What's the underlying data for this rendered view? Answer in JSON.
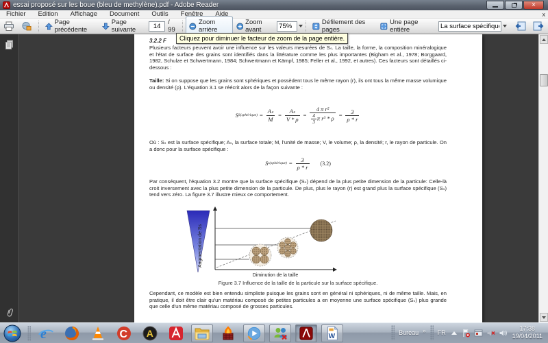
{
  "titlebar": {
    "title": "essai proposé sur les boue (bleu de methylène).pdf - Adobe Reader"
  },
  "icons": {
    "close_glyph": "×",
    "menubar_close_glyph": "x"
  },
  "menubar": {
    "items": [
      "Fichier",
      "Edition",
      "Affichage",
      "Document",
      "Outils",
      "Fenêtre",
      "Aide"
    ]
  },
  "toolbar": {
    "prev_page_label": "Page précédente",
    "next_page_label": "Page suivante",
    "page_value": "14",
    "page_total": "/ 99",
    "zoom_out_label": "Zoom arrière",
    "zoom_in_label": "Zoom avant",
    "zoom_value": "75%",
    "scroll_mode_label": "Défilement des pages",
    "fit_page_label": "Une page entière",
    "search_value": "La surface spécifique"
  },
  "tooltip": {
    "text": "Cliquez pour diminuer le facteur de zoom de la page entière."
  },
  "page": {
    "heading": "3.2.2  F",
    "para1": "Plusieurs facteurs peuvent avoir une influence sur les valeurs mesurées de Sₛ. La taille, la forme, la composition minéralogique et l'état de surface des grains sont identifiés dans la littérature comme les plus importantes (Bigham et al., 1978; Borggaard, 1982, Schulze et Schwertmann, 1984; Schwertmann et Kämpf, 1985; Feller et al., 1992, et autres). Ces facteurs sont détaillés ci- dessous :",
    "para2_lead": "Taille:",
    "para2_rest": " Si on suppose que les grains sont sphériques et possèdent tous le même rayon (r), ils ont tous la même masse volumique ou densité (ρ). L'équation 3.1 se réécrit alors de la façon suivante :",
    "eq1": {
      "lhs": "S",
      "lhs_sub": "S(sphérique)",
      "eq": "=",
      "f1_num": "Aₛ",
      "f1_den": "M",
      "f2_num": "Aₛ",
      "f2_den": "V * ρ",
      "f3_num": "4 π r²",
      "f3_mini_num": "4",
      "f3_mini_den": "3",
      "f3_den_rest": "π r³ * ρ",
      "f4_num": "3",
      "f4_den": "ρ * r"
    },
    "para3": "Où : Sₛ est la surface spécifique; Aₛ, la surface totale; M, l'unité de masse; V, le volume; ρ, la densité; r, le rayon de particule. On a donc pour la surface spécifique :",
    "eq2": {
      "lhs": "S",
      "lhs_sub": "s(sphérique)",
      "eq": "=",
      "num": "3",
      "den": "ρ * r",
      "tag": "(3.2)"
    },
    "para4": "Par conséquent, l'équation 3.2 montre que la surface spécifique (Sₛ) dépend de la plus petite dimension de la particule: Celle-là croit inversement avec la plus petite dimension de la particule. De plus, plus le rayon (r) est grand plus la surface spécifique (Sₛ) tend vers zéro. La figure 3.7 illustre mieux ce comportement.",
    "figure": {
      "triangle_label": "Augmentation de Ss",
      "x_axis_label": "Diminution de la taille",
      "caption": "Figure 3.7  Influence de la taille de la particule sur la surface spécifique."
    },
    "para5": "Cependant, ce modèle est bien entendu simpliste puisque les grains sont en général ni sphériques, ni de même taille. Mais, en pratique, il doit être clair qu'un matériau composé de petites particules a en moyenne une surface spécifique (Sₛ) plus grande que celle d'un même matériau composé de grosses particules."
  },
  "taskbar": {
    "desktop_toolbar_label": "Bureau",
    "chevron": "»",
    "language": "FR",
    "clock_time": "17:38",
    "clock_date": "19/04/2011"
  },
  "colors": {
    "tooltip_bg": "#ffffe1",
    "doc_background": "#3a3a3a",
    "page_bg": "#ffffff",
    "triangle_top": "#2a2ab8",
    "triangle_bottom": "#ccd4f8",
    "grain_fill": "#b59a76",
    "taskbar_gradient_top": "#cdd5df"
  }
}
